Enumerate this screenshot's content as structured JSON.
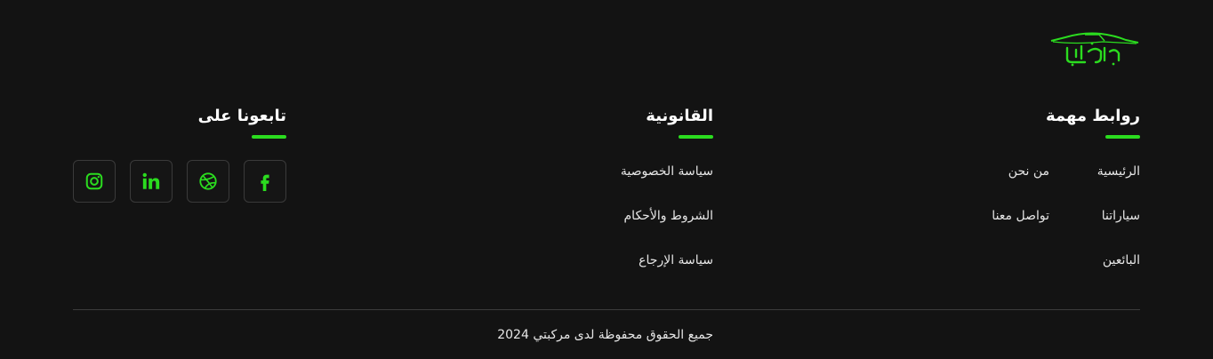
{
  "brand": {
    "logo_text": "مركبتي",
    "accent_color": "#2bdc1f",
    "background_color": "#131313"
  },
  "columns": {
    "important_links": {
      "title": "روابط مهمة",
      "links_col1": [
        "الرئيسية",
        "سياراتنا",
        "البائعين"
      ],
      "links_col2": [
        "من نحن",
        "تواصل معنا"
      ]
    },
    "legal": {
      "title": "القانونية",
      "links": [
        "سياسة الخصوصية",
        "الشروط والأحكام",
        "سياسة الإرجاع"
      ]
    },
    "follow": {
      "title": "تابعونا على",
      "icons": [
        "facebook-icon",
        "dribbble-icon",
        "linkedin-icon",
        "instagram-icon"
      ]
    }
  },
  "copyright": "جميع الحقوق محفوظة لدى مركبتي 2024"
}
